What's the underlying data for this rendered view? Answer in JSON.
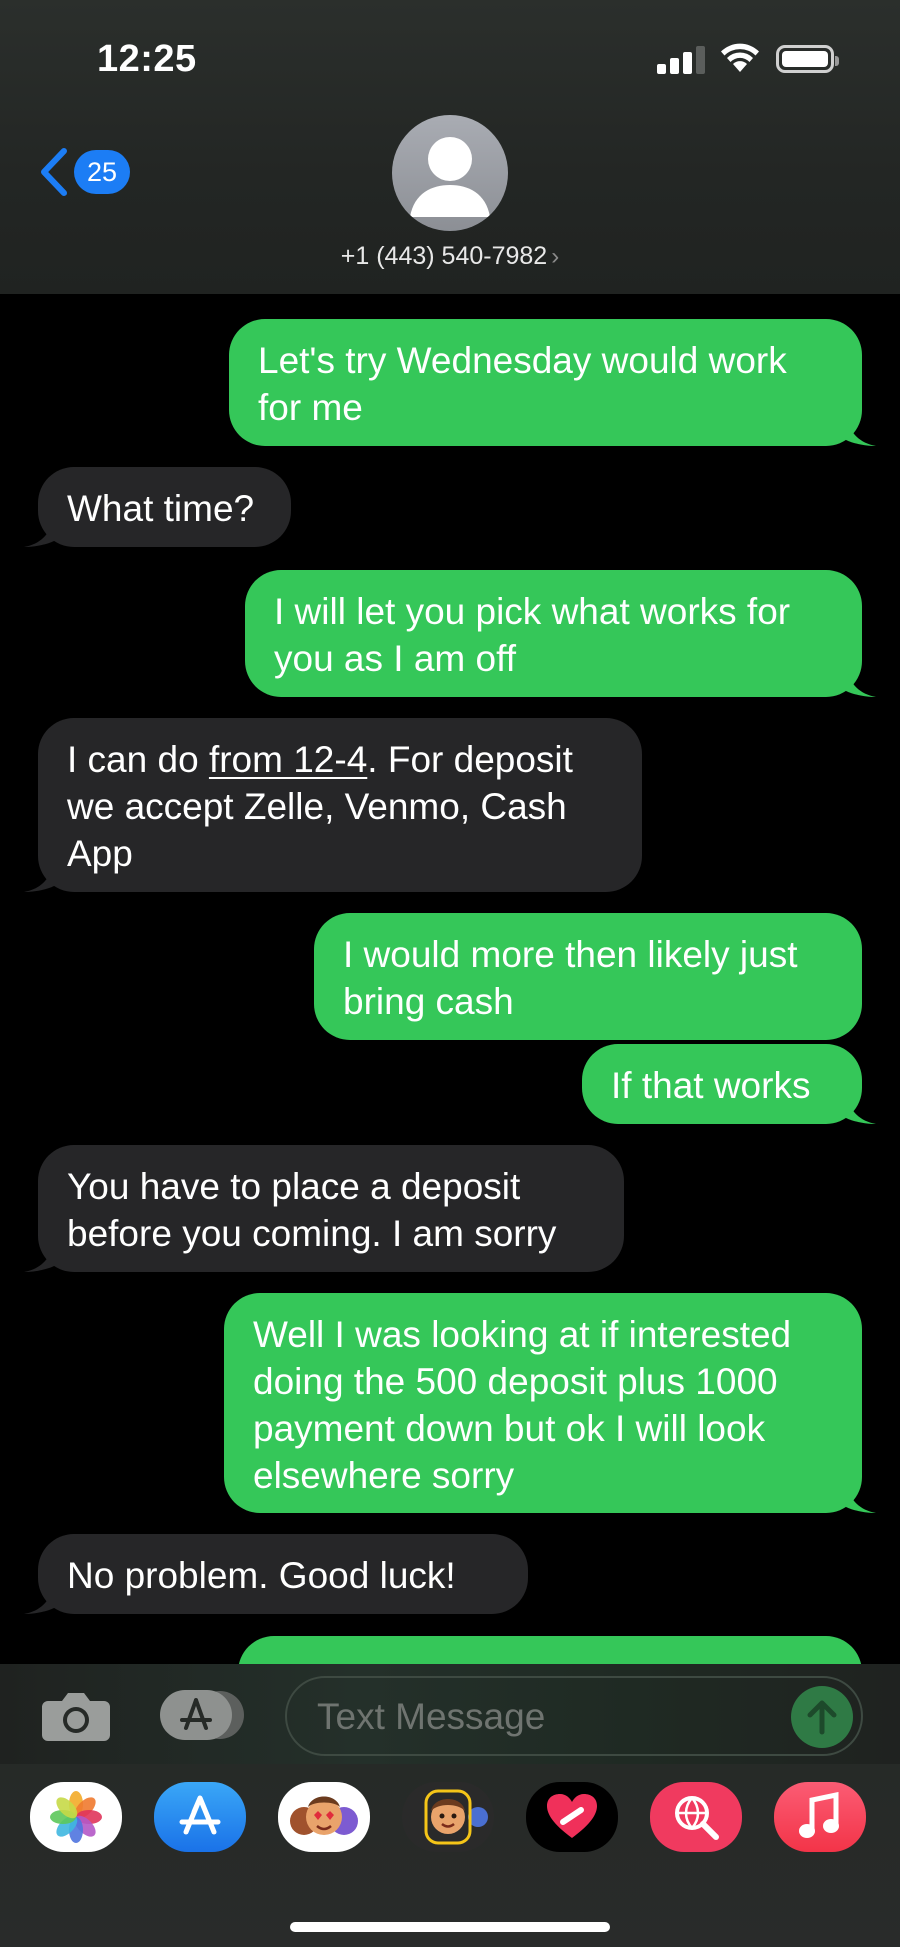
{
  "status_bar": {
    "time": "12:25"
  },
  "header": {
    "back_badge": "25",
    "contact": "+1 (443) 540-7982",
    "contact_chevron": "›"
  },
  "messages": [
    {
      "from": "me",
      "lines": [
        "Let's try Wednesday would work",
        "for me"
      ]
    },
    {
      "from": "them",
      "lines": [
        "What time?"
      ]
    },
    {
      "from": "me",
      "lines": [
        "I will let you pick what works for",
        "you as I am off"
      ]
    },
    {
      "from": "them",
      "pre": "I can do ",
      "link": "from 12-4",
      "post": ". For deposit",
      "lines2": [
        "we accept Zelle, Venmo, Cash",
        "App"
      ]
    },
    {
      "from": "me",
      "lines": [
        "I would more then likely just",
        "bring cash"
      ]
    },
    {
      "from": "me",
      "lines": [
        "If that works"
      ]
    },
    {
      "from": "them",
      "lines": [
        "You have to place a deposit",
        "before you coming. I am sorry"
      ]
    },
    {
      "from": "me",
      "lines": [
        "Well I was looking at if interested",
        "doing the 500 deposit plus 1000",
        "payment down but ok I will look",
        "elsewhere sorry"
      ]
    },
    {
      "from": "them",
      "lines": [
        "No problem.  Good luck!"
      ]
    }
  ],
  "compose": {
    "placeholder": "Text Message"
  },
  "app_drawer": [
    "photos-app",
    "app-store-app",
    "memoji-stickers-app",
    "memoji-app",
    "digital-touch-app",
    "search-images-app",
    "music-app"
  ],
  "colors": {
    "sent": "#35c759",
    "received": "#262628",
    "badge": "#1c7df5"
  }
}
